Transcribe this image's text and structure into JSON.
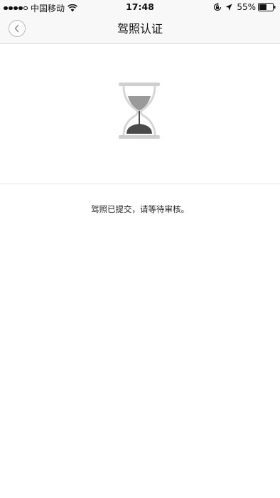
{
  "status_bar": {
    "carrier": "中国移动",
    "time": "17:48",
    "battery_percent": "55%",
    "battery_level": 0.55,
    "icons": [
      "signal-icon",
      "wifi-icon",
      "orientation-lock-icon",
      "location-icon",
      "battery-icon"
    ]
  },
  "nav": {
    "title": "驾照认证",
    "back_icon": "chevron-left-icon"
  },
  "main": {
    "illustration": "hourglass-icon",
    "message": "驾照已提交，请等待审核。"
  }
}
